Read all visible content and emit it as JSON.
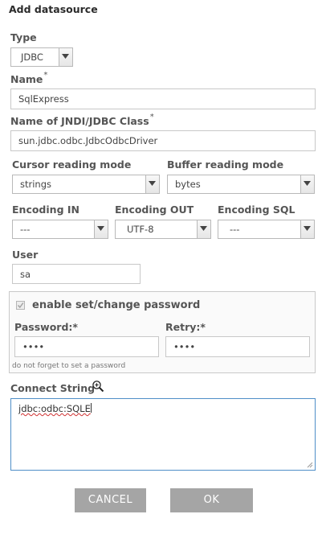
{
  "dialog": {
    "title": "Add datasource"
  },
  "type": {
    "label": "Type",
    "value": "JDBC"
  },
  "name": {
    "label": "Name",
    "required_mark": "*",
    "value": "SqlExpress"
  },
  "jndi": {
    "label": "Name of JNDI/JDBC Class",
    "required_mark": "*",
    "value": "sun.jdbc.odbc.JdbcOdbcDriver"
  },
  "cursor_mode": {
    "label": "Cursor reading mode",
    "value": "strings"
  },
  "buffer_mode": {
    "label": "Buffer reading mode",
    "value": "bytes"
  },
  "encoding_in": {
    "label": "Encoding IN",
    "value": "---"
  },
  "encoding_out": {
    "label": "Encoding OUT",
    "value": "UTF-8"
  },
  "encoding_sql": {
    "label": "Encoding SQL",
    "value": "---"
  },
  "user": {
    "label": "User",
    "value": "sa"
  },
  "password_section": {
    "checkbox_label": "enable set/change password",
    "password_label": "Password:*",
    "password_value": "••••",
    "retry_label": "Retry:*",
    "retry_value": "••••",
    "note": "do not forget to set a password"
  },
  "connect": {
    "label": "Connect String",
    "icon": "zoom-in-icon",
    "value_underlined": "jdbc:odbc:SQLE",
    "value_rest": ""
  },
  "buttons": {
    "cancel": "CANCEL",
    "ok": "OK"
  },
  "colors": {
    "focus_border": "#4f8fc7",
    "button_bg": "#a5a5a5"
  }
}
